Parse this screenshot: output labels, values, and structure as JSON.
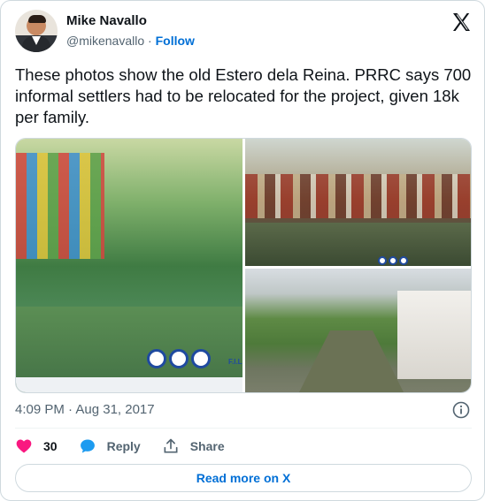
{
  "author": {
    "name": "Mike Navallo",
    "handle": "@mikenavallo",
    "separator": " · ",
    "follow_label": "Follow"
  },
  "brand_icon": "x-logo-icon",
  "tweet": {
    "text": "These photos show the old Estero dela Reina. PRRC says 700 informal settlers had to be relocated for the project, given 18k per family."
  },
  "media": {
    "photos": [
      {
        "name": "photo-left-colorful-shanties-green-water",
        "caption_text": "F.I.L"
      },
      {
        "name": "photo-top-right-houses-over-water"
      },
      {
        "name": "photo-bottom-right-creek-with-wall"
      }
    ]
  },
  "timestamp": "4:09 PM · Aug 31, 2017",
  "actions": {
    "like_count": "30",
    "reply_label": "Reply",
    "share_label": "Share"
  },
  "read_more_label": "Read more on X",
  "colors": {
    "accent": "#006fd6",
    "like": "#f91880",
    "reply": "#1d9bf0",
    "text_primary": "#0f1419",
    "text_secondary": "#536471"
  },
  "icons": [
    "x-logo-icon",
    "info-icon",
    "heart-icon",
    "reply-bubble-icon",
    "share-arrow-icon"
  ]
}
